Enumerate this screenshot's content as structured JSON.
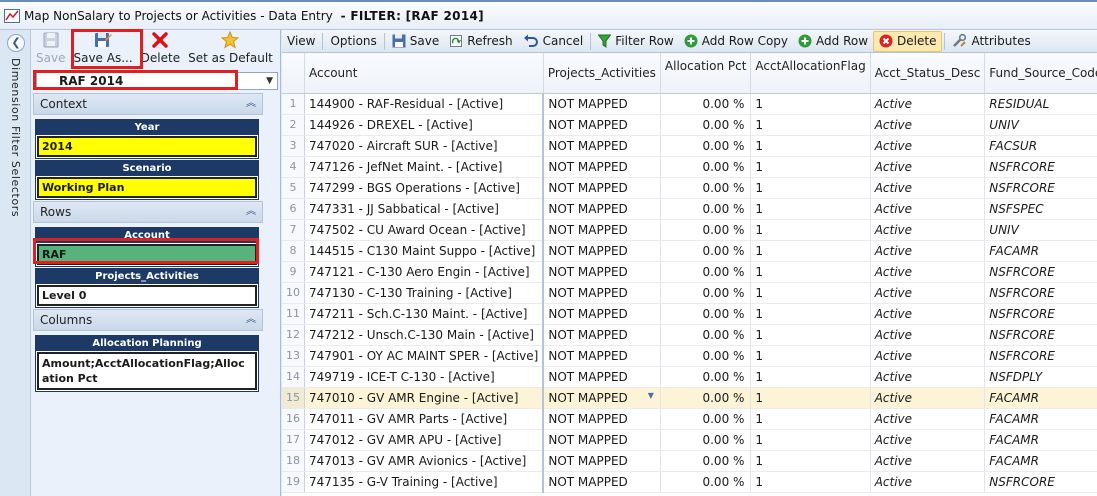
{
  "window": {
    "title": "Map NonSalary to Projects or Activities - Data Entry ",
    "filter_label": "- FILTER: [RAF 2014]"
  },
  "left_panel": {
    "side_label": "Dimension Filter Selectors",
    "toolbar": {
      "save": "Save",
      "save_as": "Save As...",
      "delete": "Delete",
      "set_default": "Set as Default"
    },
    "filter_value": "RAF 2014",
    "context": {
      "label": "Context",
      "dims": [
        {
          "title": "Year",
          "value": "2014"
        },
        {
          "title": "Scenario",
          "value": "Working Plan"
        }
      ]
    },
    "rows": {
      "label": "Rows",
      "dims": [
        {
          "title": "Account",
          "value": "RAF"
        },
        {
          "title": "Projects_Activities",
          "value": "Level 0"
        }
      ]
    },
    "columns": {
      "label": "Columns",
      "dims": [
        {
          "title": "Allocation Planning",
          "value": "Amount;AcctAllocationFlag;Allocation Pct"
        }
      ]
    }
  },
  "grid_toolbar": {
    "view": "View",
    "options": "Options",
    "save": "Save",
    "refresh": "Refresh",
    "cancel": "Cancel",
    "filter_row": "Filter Row",
    "add_row_copy": "Add Row Copy",
    "add_row": "Add Row",
    "delete": "Delete",
    "attributes": "Attributes"
  },
  "grid": {
    "columns": [
      "Account",
      "Projects_Activities",
      "Allocation Pct",
      "AcctAllocationFlag",
      "Acct_Status_Desc",
      "Fund_Source_Code"
    ],
    "selected_row": 15,
    "rows": [
      {
        "n": "1",
        "account": "144900 - RAF-Residual - [Active]",
        "proj": "NOT MAPPED",
        "pct": "0.00 %",
        "flag": "1",
        "status": "Active",
        "fund": "RESIDUAL"
      },
      {
        "n": "2",
        "account": "144926 - DREXEL - [Active]",
        "proj": "NOT MAPPED",
        "pct": "0.00 %",
        "flag": "1",
        "status": "Active",
        "fund": "UNIV"
      },
      {
        "n": "3",
        "account": "747020 - Aircraft SUR - [Active]",
        "proj": "NOT MAPPED",
        "pct": "0.00 %",
        "flag": "1",
        "status": "Active",
        "fund": "FACSUR"
      },
      {
        "n": "4",
        "account": "747126 - JefNet Maint. - [Active]",
        "proj": "NOT MAPPED",
        "pct": "0.00 %",
        "flag": "1",
        "status": "Active",
        "fund": "NSFRCORE"
      },
      {
        "n": "5",
        "account": "747299 - BGS Operations - [Active]",
        "proj": "NOT MAPPED",
        "pct": "0.00 %",
        "flag": "1",
        "status": "Active",
        "fund": "NSFRCORE"
      },
      {
        "n": "6",
        "account": "747331 - JJ Sabbatical - [Active]",
        "proj": "NOT MAPPED",
        "pct": "0.00 %",
        "flag": "1",
        "status": "Active",
        "fund": "NSFSPEC"
      },
      {
        "n": "7",
        "account": "747502 - CU Award Ocean - [Active]",
        "proj": "NOT MAPPED",
        "pct": "0.00 %",
        "flag": "1",
        "status": "Active",
        "fund": "UNIV"
      },
      {
        "n": "8",
        "account": "144515 - C130 Maint Suppo - [Active]",
        "proj": "NOT MAPPED",
        "pct": "0.00 %",
        "flag": "1",
        "status": "Active",
        "fund": "FACAMR"
      },
      {
        "n": "9",
        "account": "747121 - C-130 Aero Engin - [Active]",
        "proj": "NOT MAPPED",
        "pct": "0.00 %",
        "flag": "1",
        "status": "Active",
        "fund": "NSFRCORE"
      },
      {
        "n": "10",
        "account": "747130 - C-130 Training - [Active]",
        "proj": "NOT MAPPED",
        "pct": "0.00 %",
        "flag": "1",
        "status": "Active",
        "fund": "NSFRCORE"
      },
      {
        "n": "11",
        "account": "747211 - Sch.C-130 Maint. - [Active]",
        "proj": "NOT MAPPED",
        "pct": "0.00 %",
        "flag": "1",
        "status": "Active",
        "fund": "NSFRCORE"
      },
      {
        "n": "12",
        "account": "747212 - Unsch.C-130 Main - [Active]",
        "proj": "NOT MAPPED",
        "pct": "0.00 %",
        "flag": "1",
        "status": "Active",
        "fund": "NSFRCORE"
      },
      {
        "n": "13",
        "account": "747901 - OY AC MAINT SPER - [Active]",
        "proj": "NOT MAPPED",
        "pct": "0.00 %",
        "flag": "1",
        "status": "Active",
        "fund": "NSFRCORE"
      },
      {
        "n": "14",
        "account": "749719 - ICE-T C-130 - [Active]",
        "proj": "NOT MAPPED",
        "pct": "0.00 %",
        "flag": "1",
        "status": "Active",
        "fund": "NSFDPLY"
      },
      {
        "n": "15",
        "account": "747010 - GV AMR Engine - [Active]",
        "proj": "NOT MAPPED",
        "pct": "0.00 %",
        "flag": "1",
        "status": "Active",
        "fund": "FACAMR"
      },
      {
        "n": "16",
        "account": "747011 - GV AMR Parts - [Active]",
        "proj": "NOT MAPPED",
        "pct": "0.00 %",
        "flag": "1",
        "status": "Active",
        "fund": "FACAMR"
      },
      {
        "n": "17",
        "account": "747012 - GV AMR APU - [Active]",
        "proj": "NOT MAPPED",
        "pct": "0.00 %",
        "flag": "1",
        "status": "Active",
        "fund": "FACAMR"
      },
      {
        "n": "18",
        "account": "747013 - GV AMR Avionics - [Active]",
        "proj": "NOT MAPPED",
        "pct": "0.00 %",
        "flag": "1",
        "status": "Active",
        "fund": "FACAMR"
      },
      {
        "n": "19",
        "account": "747135 - G-V Training - [Active]",
        "proj": "NOT MAPPED",
        "pct": "0.00 %",
        "flag": "1",
        "status": "Active",
        "fund": "NSFRCORE"
      }
    ]
  }
}
